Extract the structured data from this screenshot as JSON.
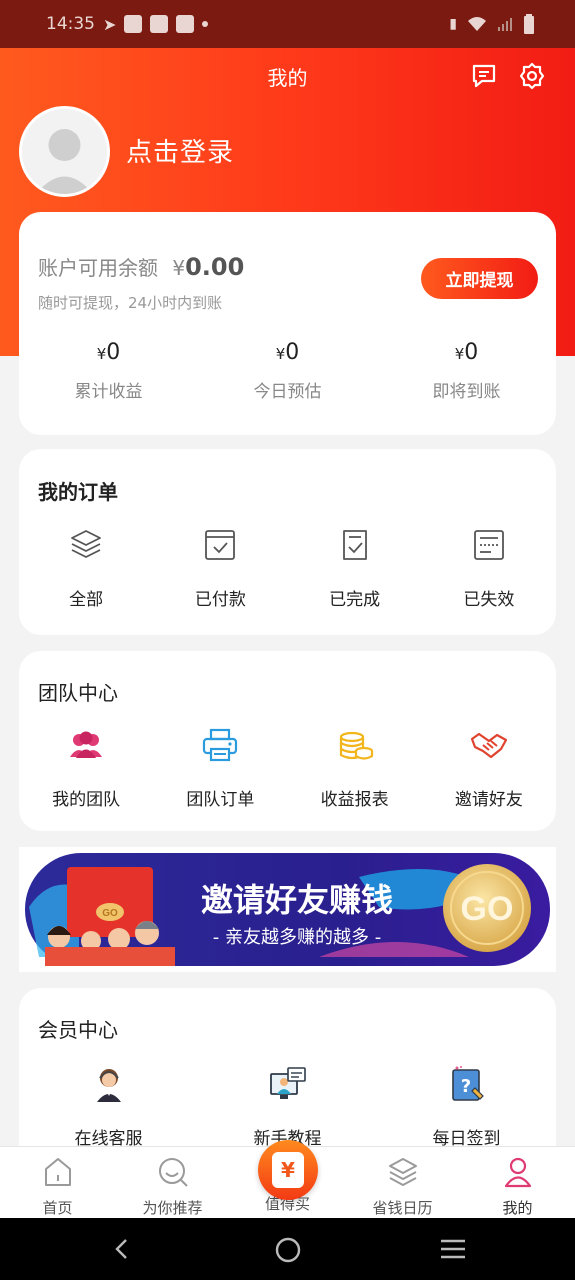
{
  "status_bar": {
    "time": "14:35"
  },
  "header": {
    "title": "我的",
    "login_text": "点击登录"
  },
  "balance": {
    "label": "账户可用余额",
    "currency": "¥",
    "amount": "0.00",
    "subtitle": "随时可提现，24小时内到账",
    "withdraw_button": "立即提现",
    "stats": [
      {
        "currency": "¥",
        "value": "0",
        "label": "累计收益"
      },
      {
        "currency": "¥",
        "value": "0",
        "label": "今日预估"
      },
      {
        "currency": "¥",
        "value": "0",
        "label": "即将到账"
      }
    ]
  },
  "orders": {
    "title": "我的订单",
    "items": [
      {
        "label": "全部",
        "icon": "layers-icon"
      },
      {
        "label": "已付款",
        "icon": "paid-icon"
      },
      {
        "label": "已完成",
        "icon": "completed-icon"
      },
      {
        "label": "已失效",
        "icon": "expired-icon"
      }
    ]
  },
  "team": {
    "title": "团队中心",
    "items": [
      {
        "label": "我的团队",
        "icon": "team-icon"
      },
      {
        "label": "团队订单",
        "icon": "printer-icon"
      },
      {
        "label": "收益报表",
        "icon": "coins-icon"
      },
      {
        "label": "邀请好友",
        "icon": "handshake-icon"
      }
    ]
  },
  "banner": {
    "headline": "邀请好友赚钱",
    "subline": "- 亲友越多赚的越多 -",
    "go": "GO",
    "envelope_text": "GO"
  },
  "member": {
    "title": "会员中心",
    "items": [
      {
        "label": "在线客服",
        "icon": "customer-service-icon"
      },
      {
        "label": "新手教程",
        "icon": "tutorial-icon"
      },
      {
        "label": "每日签到",
        "icon": "checkin-icon"
      }
    ]
  },
  "bottom_nav": [
    {
      "label": "首页",
      "icon": "home-icon"
    },
    {
      "label": "为你推荐",
      "icon": "recommend-icon"
    },
    {
      "label": "值得买",
      "icon": "worth-buy-icon"
    },
    {
      "label": "省钱日历",
      "icon": "calendar-icon"
    },
    {
      "label": "我的",
      "icon": "profile-icon"
    }
  ],
  "center_button_symbol": "¥",
  "colors": {
    "brand_start": "#ff5a1e",
    "brand_end": "#f21c14",
    "status_bar": "#7a1a10"
  }
}
